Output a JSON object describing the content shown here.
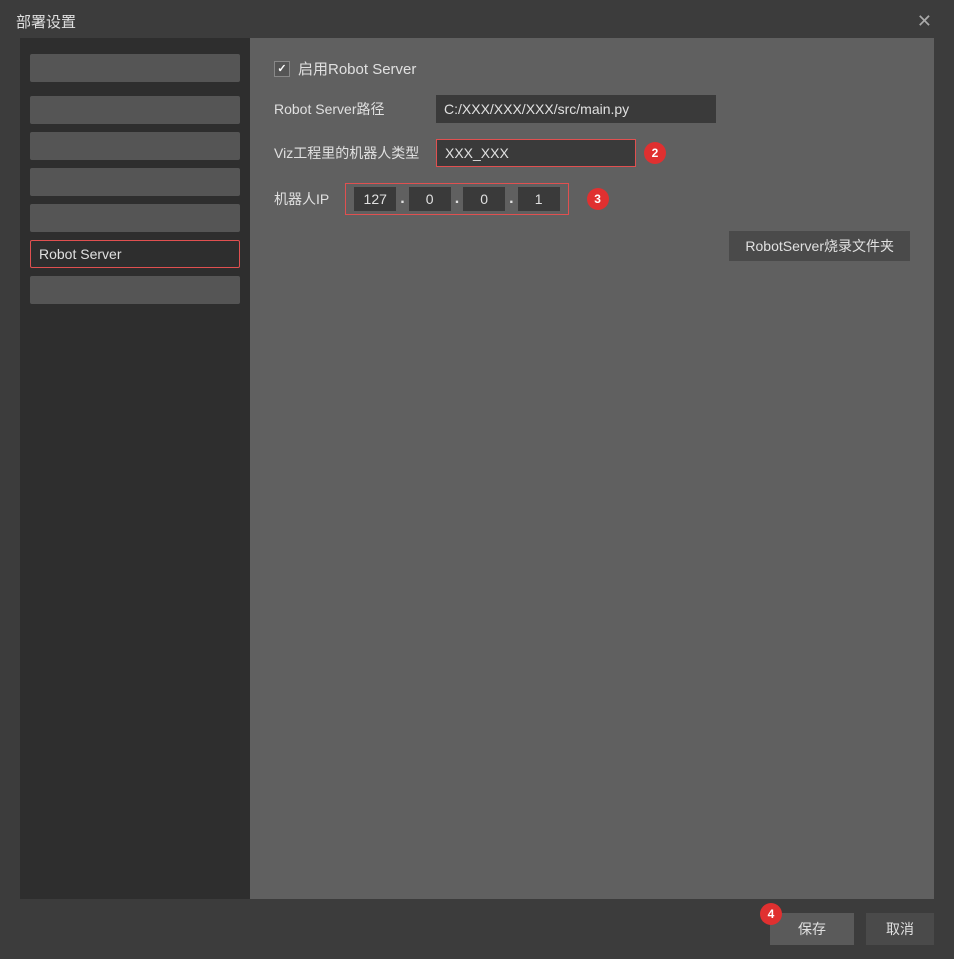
{
  "title": "部署设置",
  "close_label": "✕",
  "sidebar": {
    "items": [
      {
        "label": "",
        "type": "bar"
      },
      {
        "label": "",
        "type": "item"
      },
      {
        "label": "",
        "type": "item"
      },
      {
        "label": "",
        "type": "item"
      },
      {
        "label": "",
        "type": "item"
      },
      {
        "label": "Robot Server",
        "type": "active"
      },
      {
        "label": "",
        "type": "item-bottom"
      }
    ]
  },
  "right_panel": {
    "enable_label": "启用Robot Server",
    "path_label": "Robot Server路径",
    "path_value": "C:/XXX/XXX/XXX/src/main.py",
    "robot_type_label": "Viz工程里的机器人类型",
    "robot_type_value": "XXX_XXX",
    "robot_type_badge": "2",
    "ip_label": "机器人IP",
    "ip_seg1": "127",
    "ip_seg2": "0",
    "ip_seg3": "0",
    "ip_seg4": "1",
    "ip_badge": "3",
    "burn_folder_label": "RobotServer烧录文件夹"
  },
  "footer": {
    "save_label": "保存",
    "cancel_label": "取消",
    "save_badge": "4"
  }
}
